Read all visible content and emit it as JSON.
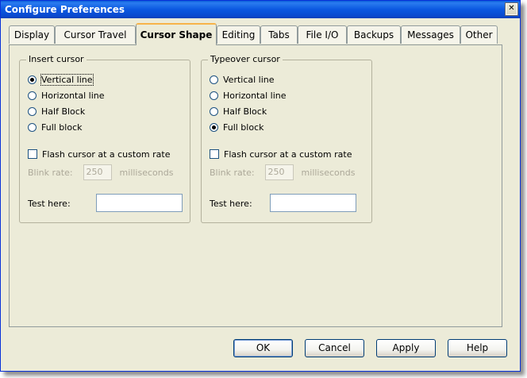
{
  "window": {
    "title": "Configure Preferences",
    "close_glyph": "✕"
  },
  "tabs": [
    {
      "label": "Display"
    },
    {
      "label": "Cursor Travel"
    },
    {
      "label": "Cursor Shape"
    },
    {
      "label": "Editing"
    },
    {
      "label": "Tabs"
    },
    {
      "label": "File I/O"
    },
    {
      "label": "Backups"
    },
    {
      "label": "Messages"
    },
    {
      "label": "Other"
    }
  ],
  "active_tab": "Cursor Shape",
  "insert": {
    "label": "Insert cursor",
    "options": [
      "Vertical line",
      "Horizontal line",
      "Half Block",
      "Full block"
    ],
    "selected": "Vertical line",
    "flash_label": "Flash cursor at a custom rate",
    "flash_checked": false,
    "blink_label": "Blink rate:",
    "blink_value": "250",
    "blink_unit": "milliseconds",
    "test_label": "Test here:",
    "test_value": ""
  },
  "typeover": {
    "label": "Typeover cursor",
    "options": [
      "Vertical line",
      "Horizontal line",
      "Half Block",
      "Full block"
    ],
    "selected": "Full block",
    "flash_label": "Flash cursor at a custom rate",
    "flash_checked": false,
    "blink_label": "Blink rate:",
    "blink_value": "250",
    "blink_unit": "milliseconds",
    "test_label": "Test here:",
    "test_value": ""
  },
  "buttons": {
    "ok": "OK",
    "cancel": "Cancel",
    "apply": "Apply",
    "help": "Help"
  },
  "colors": {
    "title_bar": "#0a5fd8",
    "dialog_bg": "#ecebd8",
    "active_tab_accent": "#f7b34a"
  }
}
